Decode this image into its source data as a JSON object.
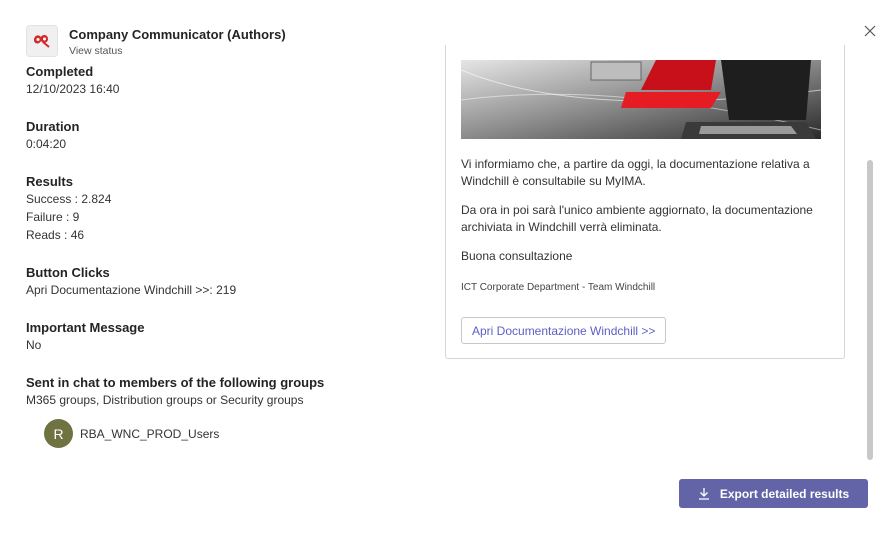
{
  "header": {
    "title": "Company Communicator (Authors)",
    "subtitle": "View status",
    "logo_icon": "company-communicator-logo"
  },
  "completed": {
    "title": "Completed",
    "value": "12/10/2023 16:40"
  },
  "duration": {
    "title": "Duration",
    "value": "0:04:20"
  },
  "results": {
    "title": "Results",
    "success": "Success : 2.824",
    "failure": "Failure : 9",
    "reads": "Reads : 46"
  },
  "button_clicks": {
    "title": "Button Clicks",
    "value": "Apri Documentazione Windchill >>: 219"
  },
  "important": {
    "title": "Important Message",
    "value": "No"
  },
  "groups": {
    "title": "Sent in chat to members of the following groups",
    "subtitle": "M365 groups, Distribution groups or Security groups",
    "items": [
      {
        "initial": "R",
        "name": "RBA_WNC_PROD_Users",
        "avatar_color": "#6f7342"
      }
    ]
  },
  "card": {
    "paragraph1": "Vi informiamo che, a partire da oggi, la documentazione relativa a Windchill è consultabile su MyIMA.",
    "paragraph2": "Da ora in poi sarà l'unico ambiente aggiornato, la documentazione archiviata in Windchill verrà eliminata.",
    "paragraph3": "Buona consultazione",
    "signature": "ICT Corporate Department - Team Windchill",
    "button_label": "Apri Documentazione Windchill >>"
  },
  "export": {
    "label": "Export detailed results",
    "icon": "download-icon",
    "color": "#6264a7"
  }
}
